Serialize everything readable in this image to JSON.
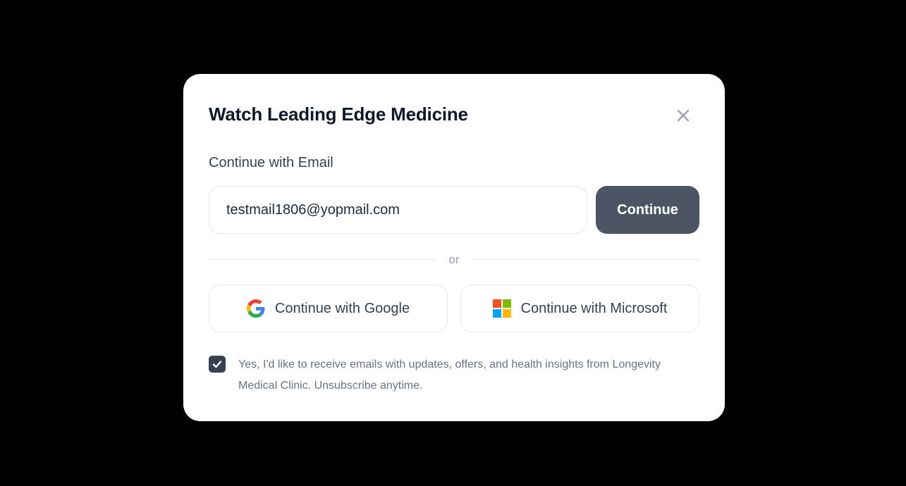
{
  "modal": {
    "title": "Watch Leading Edge Medicine",
    "close_icon": "close-icon"
  },
  "email_section": {
    "label": "Continue with Email",
    "input_value": "testmail1806@yopmail.com",
    "continue_label": "Continue"
  },
  "divider": {
    "text": "or"
  },
  "social": {
    "google": {
      "label": "Continue with Google",
      "icon": "google-icon"
    },
    "microsoft": {
      "label": "Continue with Microsoft",
      "icon": "microsoft-icon"
    }
  },
  "consent": {
    "checked": true,
    "check_icon": "checkmark-icon",
    "text": "Yes, I'd like to receive emails with updates, offers, and health insights from Longevity Medical Clinic. Unsubscribe anytime."
  },
  "colors": {
    "backdrop": "#000000",
    "modal_bg": "#ffffff",
    "title": "#111827",
    "primary_button": "#4b5563",
    "border": "#e5e7eb",
    "muted_text": "#6b7280"
  }
}
